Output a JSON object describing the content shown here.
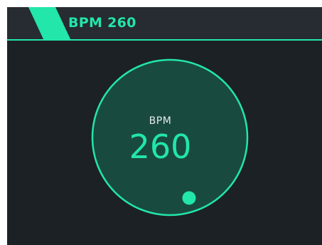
{
  "header": {
    "title": "BPM 260"
  },
  "dial": {
    "label": "BPM",
    "value": "260",
    "handle_icon": "dial-handle-icon"
  },
  "colors": {
    "accent": "#22e6aa",
    "background": "#1c2125",
    "header_background": "#262c31",
    "dial_fill": "#194a3f",
    "label_text": "#e6eceb"
  }
}
